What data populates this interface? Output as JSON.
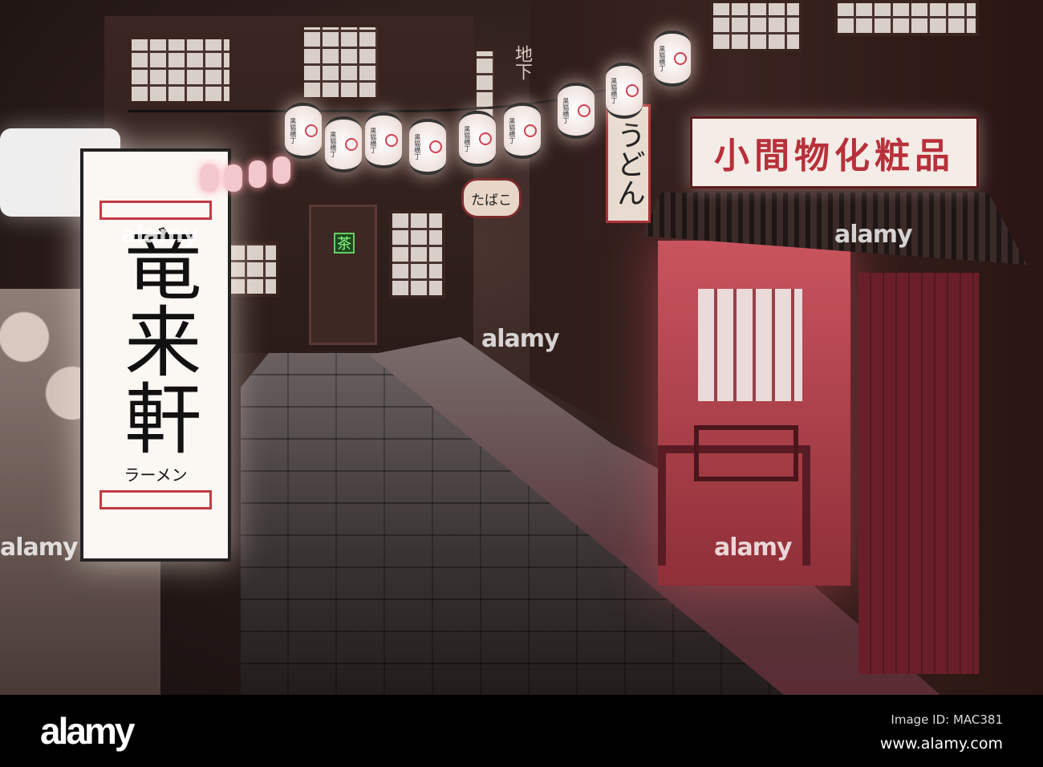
{
  "signs": {
    "ramen_shop": "竜来軒",
    "ramen_sub": "ラーメン",
    "cosmetics": "小間物化粧品",
    "udon": "うどん",
    "tobacco": "たばこ",
    "tea": "茶",
    "underground": "地下"
  },
  "lantern_text": "黒猫横丁",
  "watermark": "alamy",
  "footer": {
    "logo": "alamy",
    "image_id": "Image ID: MAC381",
    "url": "www.alamy.com"
  }
}
